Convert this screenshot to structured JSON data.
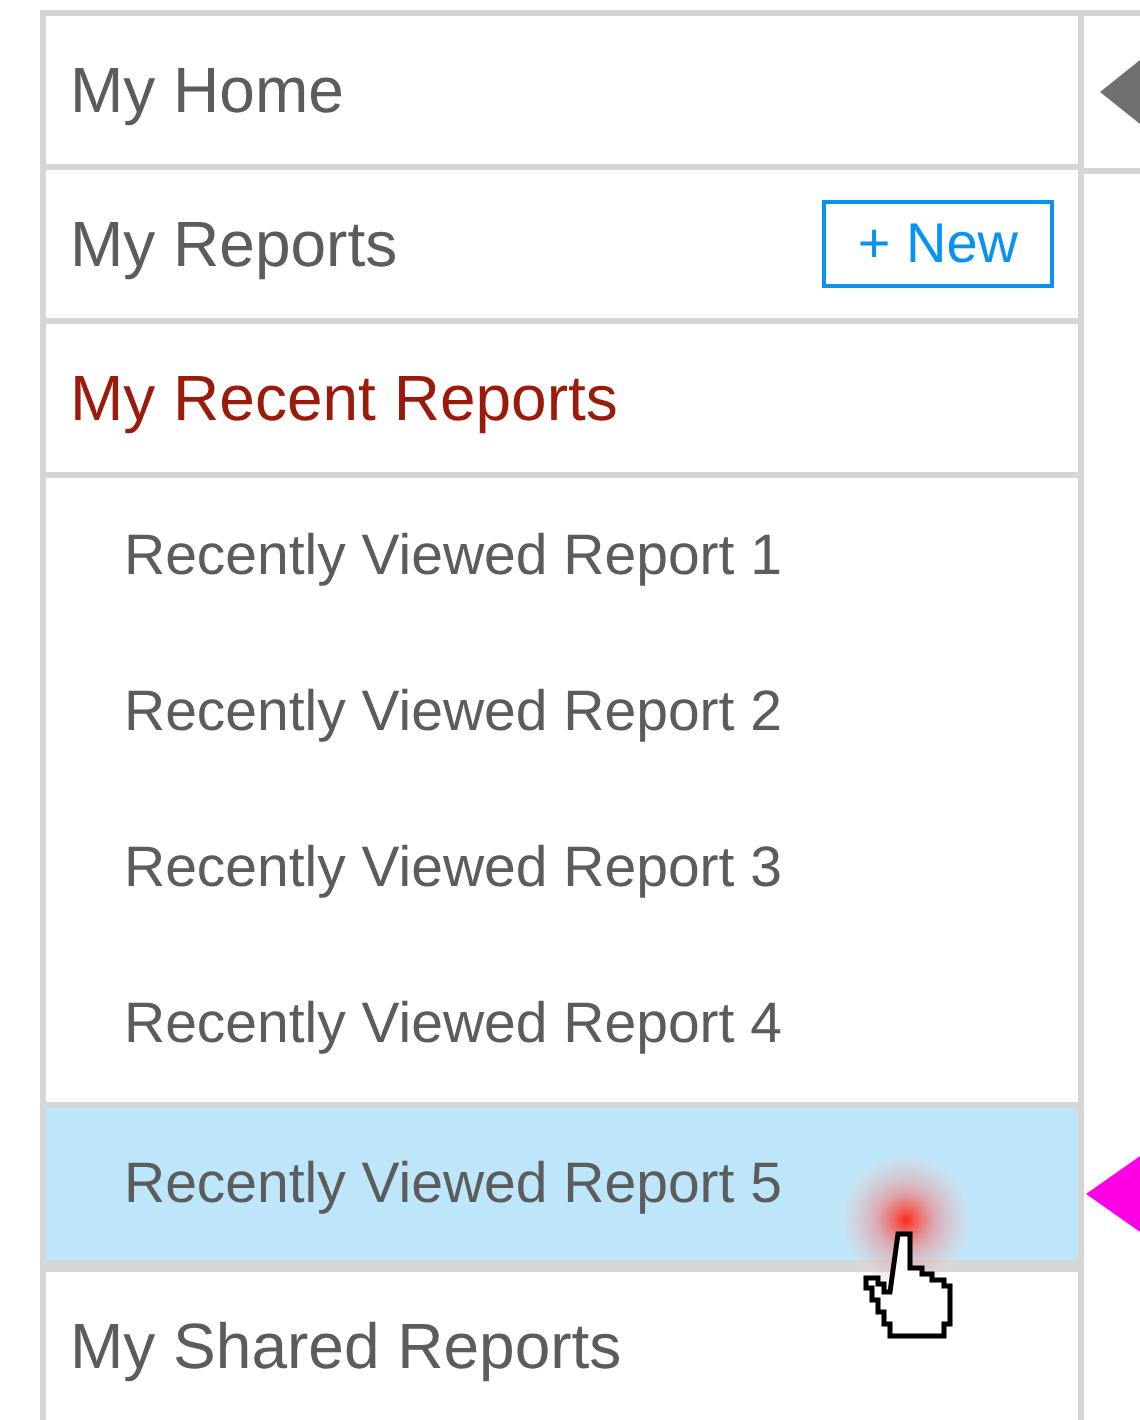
{
  "sections": [
    {
      "label": "My Home",
      "active": false
    },
    {
      "label": "My Reports",
      "active": false,
      "button": "+ New"
    },
    {
      "label": "My Recent Reports",
      "active": true,
      "children": [
        {
          "label": "Recently Viewed Report 1",
          "selected": false
        },
        {
          "label": "Recently Viewed Report 2",
          "selected": false
        },
        {
          "label": "Recently Viewed Report 3",
          "selected": false
        },
        {
          "label": "Recently Viewed Report 4",
          "selected": false
        },
        {
          "label": "Recently Viewed Report 5",
          "selected": true
        }
      ]
    },
    {
      "label": "My Shared Reports",
      "active": false
    }
  ]
}
